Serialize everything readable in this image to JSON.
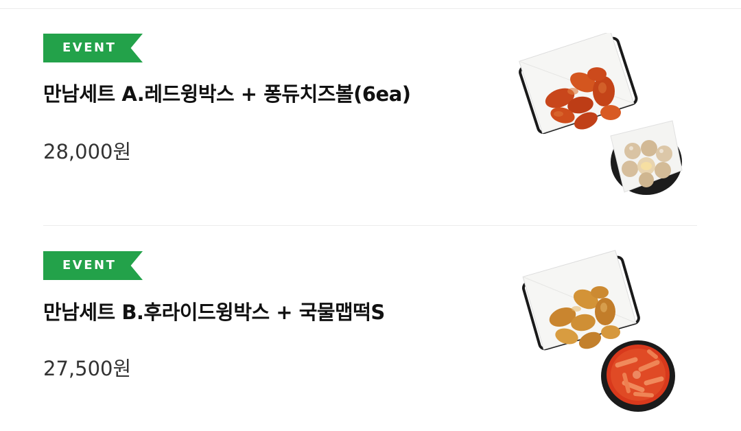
{
  "menu": {
    "items": [
      {
        "badge": "EVENT",
        "name": "만남세트 A.레드윙박스 + 퐁듀치즈볼(6ea)",
        "price": "28,000원",
        "image_icon": "chicken-wings-and-cheese-balls-photo"
      },
      {
        "badge": "EVENT",
        "name": "만남세트 B.후라이드윙박스 + 국물맵떡S",
        "price": "27,500원",
        "image_icon": "fried-wings-and-tteokbokki-photo"
      }
    ]
  },
  "colors": {
    "badge_bg": "#23a24a",
    "badge_text": "#ffffff",
    "title_text": "#111111",
    "price_text": "#333333",
    "divider": "#ececec"
  }
}
